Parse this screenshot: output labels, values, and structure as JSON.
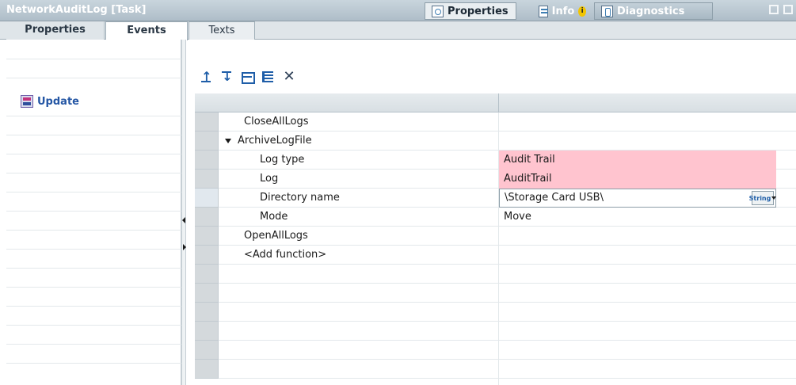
{
  "window": {
    "title": "NetworkAuditLog [Task]",
    "tabs": [
      {
        "label": "Properties",
        "icon": "magnifier-icon"
      },
      {
        "label": "Info",
        "icon": "info-icon",
        "badge": "i"
      },
      {
        "label": "Diagnostics",
        "icon": "diagnostics-icon"
      }
    ]
  },
  "subtabs": [
    "Properties",
    "Events",
    "Texts"
  ],
  "events": {
    "items": [
      {
        "label": "Update",
        "icon": "event-icon"
      }
    ]
  },
  "toolbar": {
    "buttons": [
      "move-up-icon",
      "move-down-icon",
      "folder-icon",
      "list-icon",
      "delete-icon"
    ]
  },
  "functions": {
    "rows": [
      {
        "name": "CloseAllLogs",
        "value": ""
      },
      {
        "name": "ArchiveLogFile",
        "value": "",
        "expanded": true
      },
      {
        "name": "Log type",
        "value": "Audit Trail",
        "highlight": "#ffc4cf"
      },
      {
        "name": "Log",
        "value": "AuditTrail",
        "highlight": "#ffc4cf"
      },
      {
        "name": "Directory name",
        "value": "\\Storage Card USB\\",
        "type_button": "String"
      },
      {
        "name": "Mode",
        "value": "Move"
      },
      {
        "name": "OpenAllLogs",
        "value": ""
      },
      {
        "name": "<Add function>",
        "value": ""
      }
    ]
  }
}
